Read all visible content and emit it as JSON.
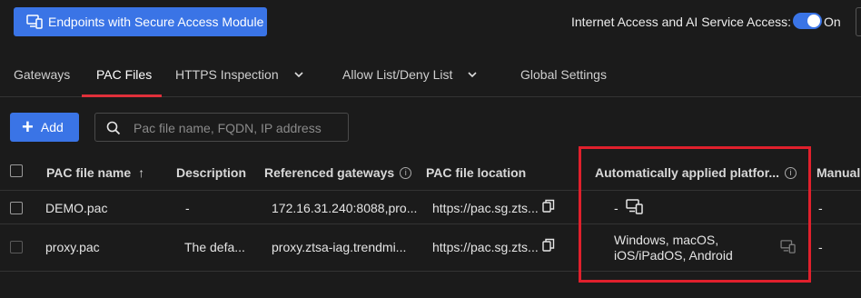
{
  "header": {
    "endpoints_button": "Endpoints with Secure Access Module",
    "access_label": "Internet Access and AI Service Access:",
    "toggle_label": "On"
  },
  "tabs": [
    {
      "label": "Gateways"
    },
    {
      "label": "PAC Files"
    },
    {
      "label": "HTTPS Inspection"
    },
    {
      "label": "Allow List/Deny List"
    },
    {
      "label": "Global Settings"
    }
  ],
  "toolbar": {
    "add_label": "Add",
    "search_placeholder": "Pac file name, FQDN, IP address"
  },
  "table": {
    "columns": [
      "PAC file name",
      "Description",
      "Referenced gateways",
      "PAC file location",
      "Automatically applied platfor...",
      "Manuall"
    ],
    "sort_indicator": "↑",
    "rows": [
      {
        "name": "DEMO.pac",
        "description": "-",
        "gateways": "172.16.31.240:8088,pro...",
        "location": "https://pac.sg.zts...",
        "platforms": "-",
        "manual": "-"
      },
      {
        "name": "proxy.pac",
        "description": "The defa...",
        "gateways": "proxy.ztsa-iag.trendmi...",
        "location": "https://pac.sg.zts...",
        "platforms_line1": "Windows, macOS,",
        "platforms_line2": "iOS/iPadOS, Android",
        "manual": "-"
      }
    ]
  },
  "colors": {
    "accent": "#3a74e6",
    "highlight": "#e0202c",
    "background": "#1b1b1b"
  }
}
